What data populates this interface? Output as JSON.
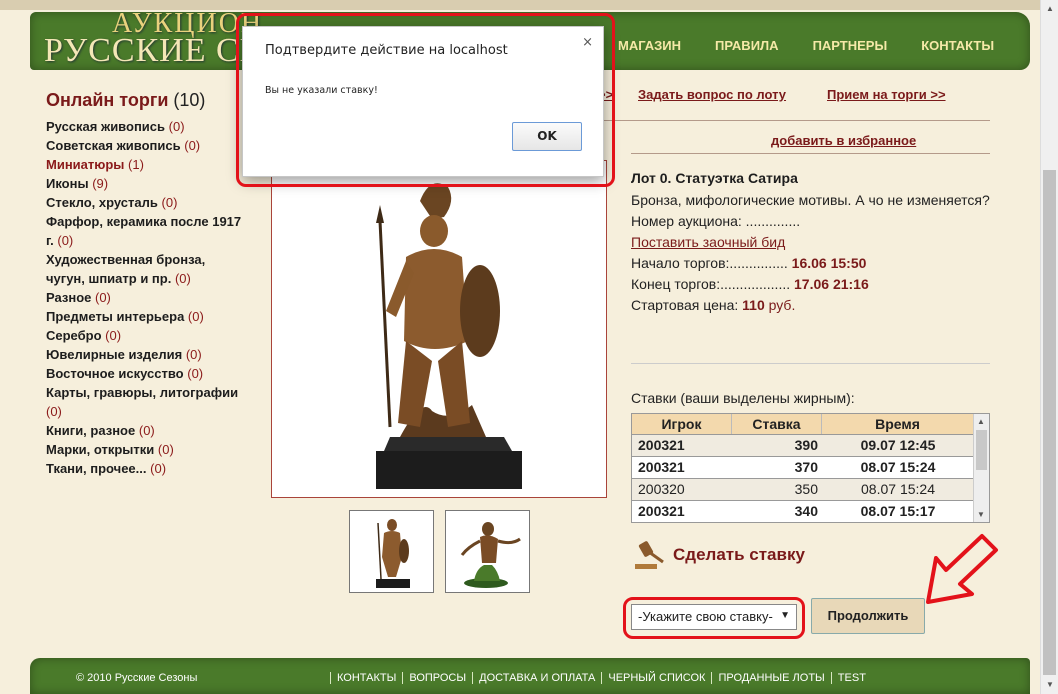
{
  "header": {
    "logo_line1": "АУКЦИОН",
    "logo_line2": "РУССКИЕ СЕЗОНЫ",
    "nav": [
      "МАГАЗИН",
      "ПРАВИЛА",
      "ПАРТНЕРЫ",
      "КОНТАКТЫ"
    ]
  },
  "sidebar": {
    "title": "Онлайн торги",
    "title_count": "(10)",
    "categories": [
      {
        "label": "Русская живопись",
        "count": "(0)"
      },
      {
        "label": "Советская живопись",
        "count": "(0)"
      },
      {
        "label": "Миниатюры",
        "count": "(1)"
      },
      {
        "label": "Иконы",
        "count": "(9)"
      },
      {
        "label": "Стекло, хрусталь",
        "count": "(0)"
      },
      {
        "label": "Фарфор, керамика после 1917 г.",
        "count": "(0)"
      },
      {
        "label": "Художественная бронза, чугун, шпиатр и пр.",
        "count": "(0)"
      },
      {
        "label": "Разное",
        "count": "(0)"
      },
      {
        "label": "Предметы интерьера",
        "count": "(0)"
      },
      {
        "label": "Серебро",
        "count": "(0)"
      },
      {
        "label": "Ювелирные изделия",
        "count": "(0)"
      },
      {
        "label": "Восточное искусство",
        "count": "(0)"
      },
      {
        "label": "Карты, гравюры, литографии",
        "count": "(0)"
      },
      {
        "label": "Книги, разное",
        "count": "(0)"
      },
      {
        "label": "Марки, открытки",
        "count": "(0)"
      },
      {
        "label": "Ткани, прочее...",
        "count": "(0)"
      }
    ]
  },
  "links": {
    "partial": ">>",
    "ask_question": "Задать вопрос по лоту",
    "accept_to_auction": "Прием на торги >>",
    "add_favorite": "добавить в избранное"
  },
  "lot": {
    "title": "Лот 0. Статуэтка Сатира",
    "description": "Бронза, мифологические мотивы. А чо не изменяется?",
    "auction_number_label": "Номер аукциона: ..............",
    "absentee_bid": "Поставить заочный бид",
    "start_label": "Начало торгов:...............",
    "start_value": "16.06 15:50",
    "end_label": "Конец торгов:..................",
    "end_value": "17.06 21:16",
    "price_label": "Стартовая цена:",
    "price_value": "110",
    "price_unit": "руб."
  },
  "bids": {
    "caption": "Ставки (ваши выделены жирным):",
    "columns": [
      "Игрок",
      "Ставка",
      "Время"
    ],
    "rows": [
      {
        "player": "200321",
        "amount": "390",
        "time": "09.07 12:45"
      },
      {
        "player": "200321",
        "amount": "370",
        "time": "08.07 15:24"
      },
      {
        "player": "200320",
        "amount": "350",
        "time": "08.07 15:24"
      },
      {
        "player": "200321",
        "amount": "340",
        "time": "08.07 15:17"
      }
    ]
  },
  "bid_action": {
    "make_bid": "Сделать ставку",
    "select_value": "-Укажите свою ставку-",
    "continue": "Продолжить"
  },
  "footer": {
    "copyright": "© 2010 Русские Сезоны",
    "nav": [
      "КОНТАКТЫ",
      "ВОПРОСЫ",
      "ДОСТАВКА И ОПЛАТА",
      "ЧЕРНЫЙ СПИСОК",
      "ПРОДАННЫЕ ЛОТЫ",
      "TEST"
    ]
  },
  "dialog": {
    "title": "Подтвердите действие на localhost",
    "close": "×",
    "message": "Вы не указали ставку!",
    "ok": "OK"
  },
  "colors": {
    "accent": "#7a1a1a",
    "header_green": "#4a7a2a",
    "highlight_red": "#e3121a",
    "background": "#f6efdc"
  }
}
